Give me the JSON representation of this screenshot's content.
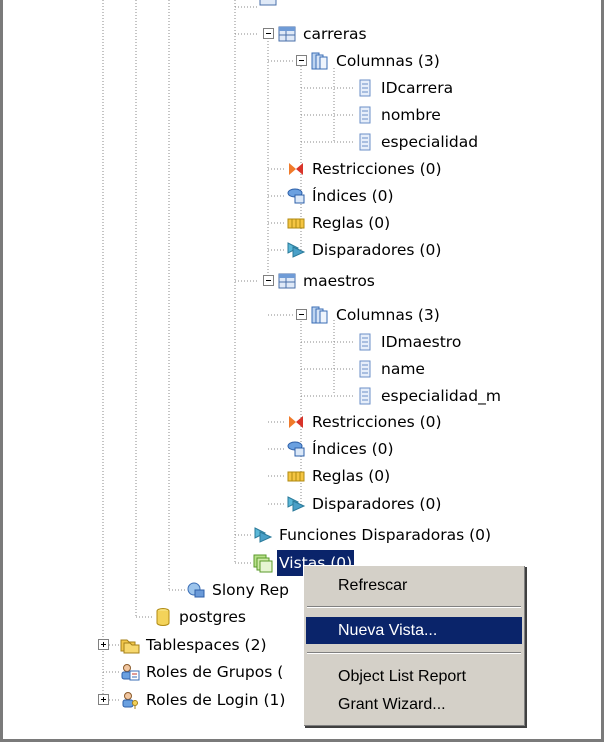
{
  "tree": {
    "carreras": {
      "label": "carreras",
      "columnas": "Columnas (3)",
      "columns": [
        "IDcarrera",
        "nombre",
        "especialidad"
      ],
      "restricciones": "Restricciones (0)",
      "indices": "Índices (0)",
      "reglas": "Reglas (0)",
      "disparadores": "Disparadores (0)"
    },
    "maestros": {
      "label": "maestros",
      "columnas": "Columnas (3)",
      "columns": [
        "IDmaestro",
        "name",
        "especialidad_m"
      ],
      "restricciones": "Restricciones (0)",
      "indices": "Índices (0)",
      "reglas": "Reglas (0)",
      "disparadores": "Disparadores (0)"
    },
    "funciones_disparadoras": "Funciones Disparadoras (0)",
    "vistas": "Vistas (0)",
    "slony": "Slony Rep",
    "postgres": "postgres",
    "tablespaces": "Tablespaces (2)",
    "roles_grupos": "Roles de Grupos (",
    "roles_login": "Roles de Login (1)"
  },
  "context_menu": {
    "refrescar": "Refrescar",
    "nueva_vista": "Nueva Vista...",
    "object_list_report": "Object List Report",
    "grant_wizard": "Grant Wizard..."
  },
  "colors": {
    "selection": "#0a246a",
    "menu_bg": "#d4d0c8",
    "tree_lines": "#808080"
  }
}
